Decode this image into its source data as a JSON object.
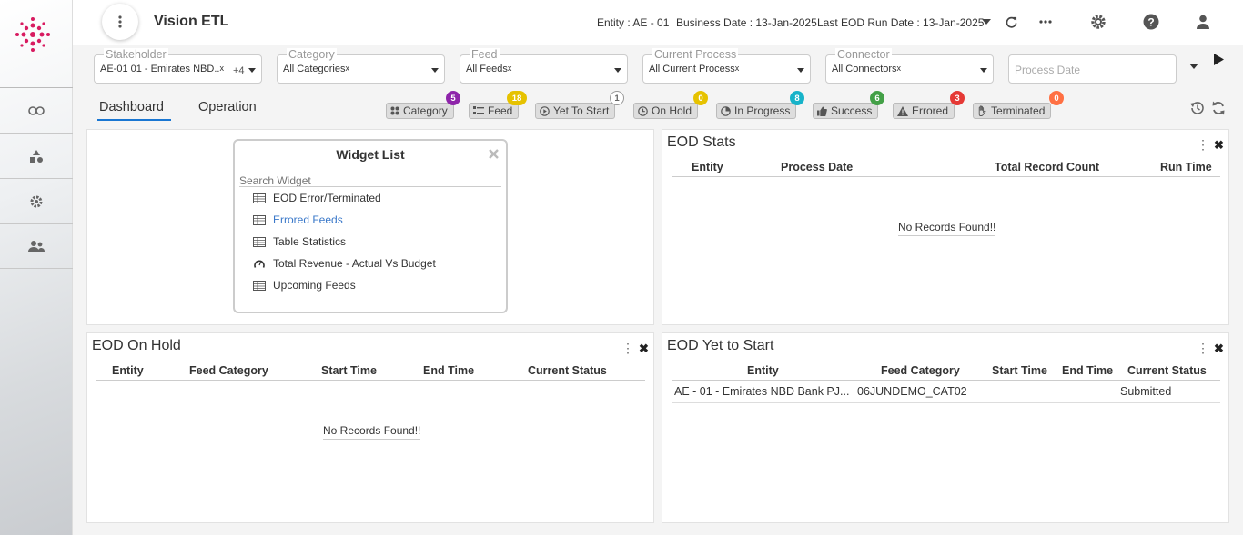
{
  "header": {
    "title": "Vision ETL",
    "entity": "Entity : AE - 01",
    "business_date": "Business Date : 13-Jan-2025",
    "last_eod": "Last EOD Run Date : 13-Jan-2025"
  },
  "filters": {
    "stakeholder": {
      "label": "Stakeholder",
      "value": "AE-01 01 - Emirates NBD..",
      "extra": "+4"
    },
    "category": {
      "label": "Category",
      "value": "All Categories"
    },
    "feed": {
      "label": "Feed",
      "value": "All Feeds"
    },
    "current_process": {
      "label": "Current Process",
      "value": "All Current Process"
    },
    "connector": {
      "label": "Connector",
      "value": "All Connectors"
    },
    "process_date": {
      "placeholder": "Process Date"
    },
    "clear_mark": "x"
  },
  "tabs": {
    "dashboard": "Dashboard",
    "operation": "Operation"
  },
  "chips": [
    {
      "label": "Category",
      "count": "5",
      "color": "#8e24aa"
    },
    {
      "label": "Feed",
      "count": "18",
      "color": "#e6c200"
    },
    {
      "label": "Yet To Start",
      "count": "1",
      "color": "#ffffff"
    },
    {
      "label": "On Hold",
      "count": "0",
      "color": "#e6c200"
    },
    {
      "label": "In Progress",
      "count": "8",
      "color": "#17b3c9"
    },
    {
      "label": "Success",
      "count": "6",
      "color": "#43a047"
    },
    {
      "label": "Errored",
      "count": "3",
      "color": "#e53935"
    },
    {
      "label": "Terminated",
      "count": "0",
      "color": "#ff7043"
    }
  ],
  "widget_list": {
    "title": "Widget List",
    "search_placeholder": "Search Widget",
    "items": [
      "EOD Error/Terminated",
      "Errored Feeds",
      "Table Statistics",
      "Total Revenue - Actual Vs Budget",
      "Upcoming Feeds"
    ]
  },
  "eod_stats": {
    "title": "EOD Stats",
    "columns": [
      "Entity",
      "Process Date",
      "Total Record Count",
      "Run Time"
    ],
    "empty": "No Records Found!!"
  },
  "eod_on_hold": {
    "title": "EOD On Hold",
    "columns": [
      "Entity",
      "Feed Category",
      "Start Time",
      "End Time",
      "Current Status"
    ],
    "empty": "No Records Found!!"
  },
  "eod_yet_to_start": {
    "title": "EOD Yet to Start",
    "columns": [
      "Entity",
      "Feed Category",
      "Start Time",
      "End Time",
      "Current Status"
    ],
    "rows": [
      {
        "entity": "AE - 01 - Emirates NBD Bank PJ...",
        "feed_category": "06JUNDEMO_CAT02",
        "start_time": "",
        "end_time": "",
        "status": "Submitted"
      }
    ]
  },
  "panel_icons": {
    "menu": "⋮",
    "close": "✖"
  }
}
